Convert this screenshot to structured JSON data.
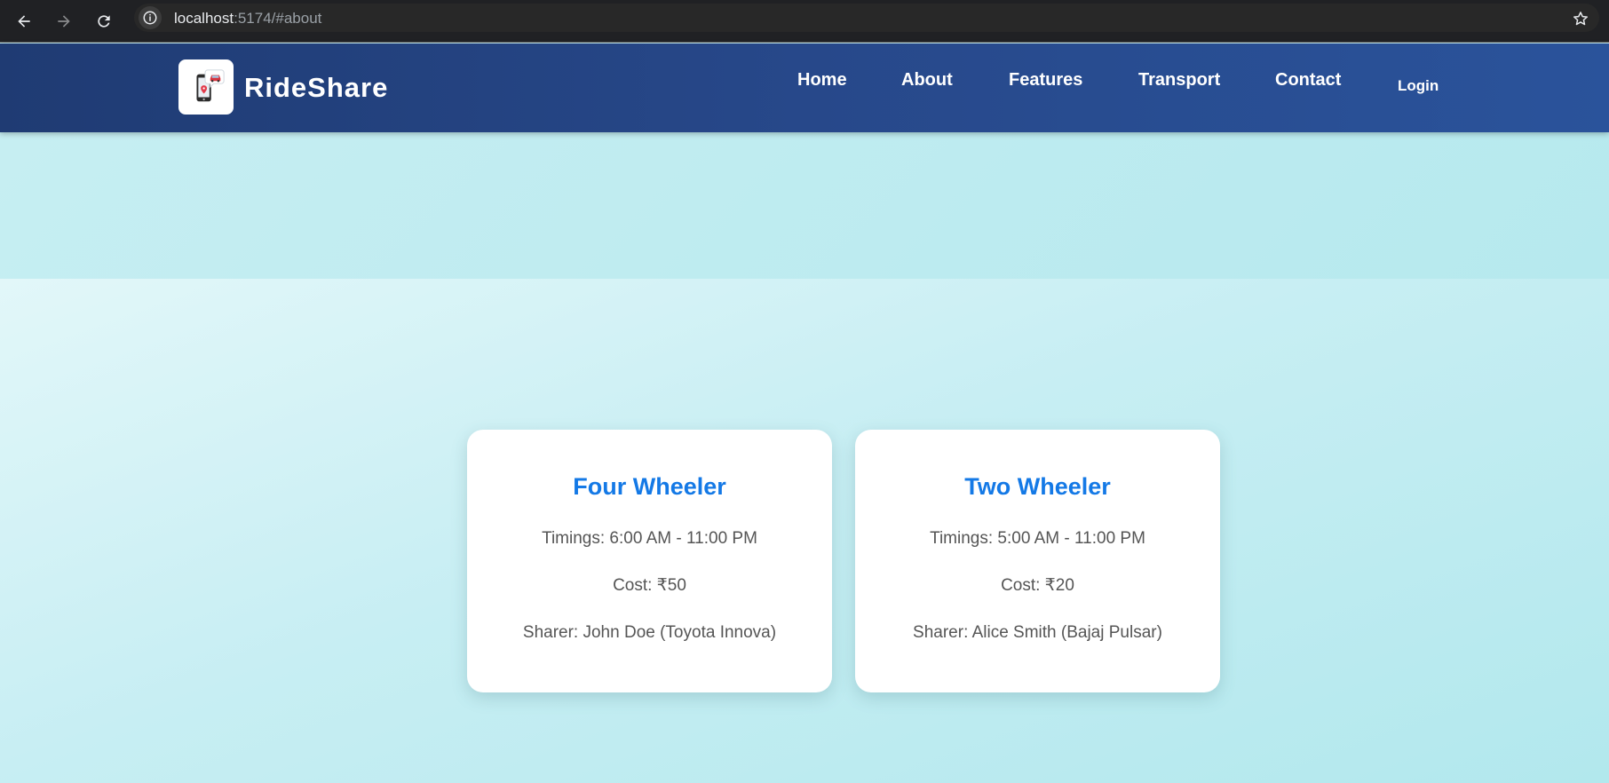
{
  "browser": {
    "url_host": "localhost",
    "url_rest": ":5174/#about",
    "icons": {
      "back": "arrow-left-icon",
      "forward": "arrow-right-icon",
      "reload": "reload-icon",
      "site_info": "info-icon",
      "bookmark": "star-icon"
    }
  },
  "header": {
    "brand": "RideShare",
    "logo_icon": "phone-car-location-icon",
    "nav": {
      "home": "Home",
      "about": "About",
      "features": "Features",
      "transport": "Transport",
      "contact": "Contact",
      "login": "Login"
    }
  },
  "cards": [
    {
      "title": "Four Wheeler",
      "timings": "Timings: 6:00 AM - 11:00 PM",
      "cost": "Cost: ₹50",
      "sharer": "Sharer: John Doe (Toyota Innova)"
    },
    {
      "title": "Two Wheeler",
      "timings": "Timings: 5:00 AM - 11:00 PM",
      "cost": "Cost: ₹20",
      "sharer": "Sharer: Alice Smith (Bajaj Pulsar)"
    }
  ],
  "colors": {
    "header_start": "#1f3b73",
    "header_end": "#2a539b",
    "card_title": "#1479e6",
    "card_text": "#555555",
    "page_bg": "#c6eef2"
  }
}
